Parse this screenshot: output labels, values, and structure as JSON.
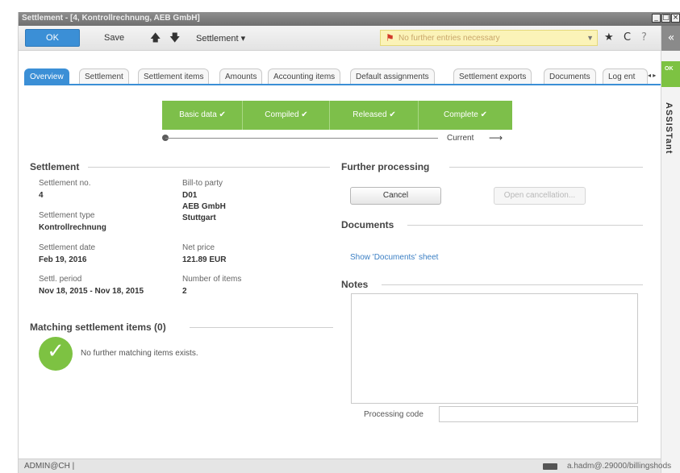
{
  "window": {
    "title": "Settlement - [4, Kontrollrechnung, AEB GmbH]",
    "controls": [
      "_",
      "□",
      "×"
    ]
  },
  "toolbar": {
    "ok_label": "OK",
    "save_label": "Save",
    "up_icon": "arrow-up-icon",
    "down_icon": "arrow-down-icon",
    "menu_label": "Settlement ▾",
    "notice_text": "No further entries necessary",
    "star_icon": "★",
    "refresh_icon": "C",
    "help_icon": "?"
  },
  "assistant": {
    "collapse": "«",
    "badge": "OK",
    "label": "ASSISTant"
  },
  "tabs": [
    "Overview",
    "Settlement",
    "Settlement items",
    "Amounts",
    "Accounting items",
    "Default assignments",
    "Settlement exports",
    "Documents",
    "Log ent"
  ],
  "tab_more": "◂ ▸",
  "steps": [
    {
      "label": "Basic data",
      "done": true
    },
    {
      "label": "Compiled",
      "done": true
    },
    {
      "label": "Released",
      "done": true
    },
    {
      "label": "Complete",
      "done": true
    }
  ],
  "progress": {
    "current_label": "Current",
    "arrow": "⟶"
  },
  "settlement": {
    "title": "Settlement",
    "no_label": "Settlement no.",
    "no_value": "4",
    "type_label": "Settlement type",
    "type_value": "Kontrollrechnung",
    "date_label": "Settlement date",
    "date_value": "Feb 19, 2016",
    "period_label": "Settl. period",
    "period_value": "Nov 18, 2015 - Nov 18, 2015",
    "billto_label": "Bill-to party",
    "billto_code": "D01",
    "billto_name": "AEB GmbH",
    "billto_city": "Stuttgart",
    "netprice_label": "Net price",
    "netprice_value": "121.89 EUR",
    "items_label": "Number of items",
    "items_value": "2"
  },
  "matching": {
    "title": "Matching settlement items (0)",
    "message": "No further matching items exists."
  },
  "further": {
    "title": "Further processing",
    "cancel_label": "Cancel",
    "open_cancel_label": "Open cancellation..."
  },
  "documents": {
    "title": "Documents",
    "link": "Show 'Documents' sheet"
  },
  "notes": {
    "title": "Notes",
    "processing_code_label": "Processing code",
    "processing_code_value": ""
  },
  "statusbar": {
    "user": "ADMIN@CH |",
    "server": "a.hadm@.29000/billingshods"
  },
  "colors": {
    "accent": "#3b8fd6",
    "step_green": "#7dbf4a",
    "notice_bg": "#fbf3b8"
  }
}
